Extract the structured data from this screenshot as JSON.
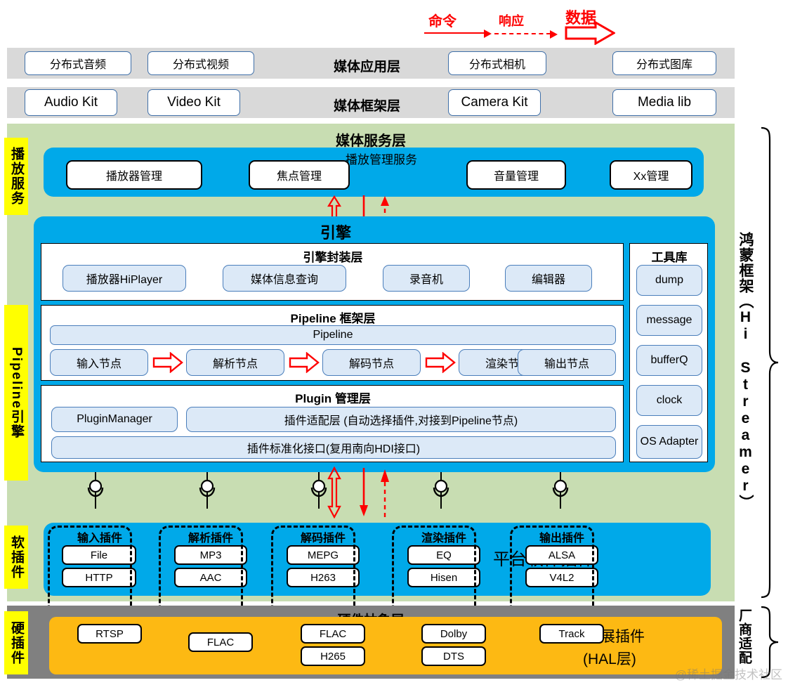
{
  "legend": {
    "command": "命令",
    "response": "响应",
    "data": "数据"
  },
  "layers": {
    "app": {
      "title": "媒体应用层",
      "items": [
        "分布式音频",
        "分布式视频",
        "分布式相机",
        "分布式图库"
      ]
    },
    "framework": {
      "title": "媒体框架层",
      "items": [
        "Audio Kit",
        "Video Kit",
        "Camera Kit",
        "Media lib"
      ]
    },
    "service": {
      "title": "媒体服务层",
      "panel_label": "播放管理服务",
      "items": [
        "播放器管理",
        "焦点管理",
        "音量管理",
        "Xx管理"
      ]
    },
    "engine": {
      "title": "引擎",
      "wrapper": {
        "title": "引擎封装层",
        "items": [
          "播放器HiPlayer",
          "媒体信息查询",
          "录音机",
          "编辑器"
        ]
      },
      "pipeline": {
        "title": "Pipeline 框架层",
        "bar": "Pipeline",
        "nodes": [
          "输入节点",
          "解析节点",
          "解码节点",
          "渲染节点",
          "输出节点"
        ]
      },
      "plugin": {
        "title": "Plugin 管理层",
        "manager": "PluginManager",
        "adapter": "插件适配层 (自动选择插件,对接到Pipeline节点)",
        "standard": "插件标准化接口(复用南向HDI接口)"
      },
      "toolkit": {
        "title": "工具库",
        "items": [
          "dump",
          "message",
          "bufferQ",
          "clock",
          "OS Adapter"
        ]
      }
    },
    "soft_plugins": {
      "label": "平台软件插件",
      "groups": [
        {
          "title": "输入插件",
          "items": [
            "File",
            "HTTP"
          ]
        },
        {
          "title": "解析插件",
          "items": [
            "MP3",
            "AAC"
          ]
        },
        {
          "title": "解码插件",
          "items": [
            "MEPG",
            "H263"
          ]
        },
        {
          "title": "渲染插件",
          "items": [
            "EQ",
            "Hisen"
          ]
        },
        {
          "title": "输出插件",
          "items": [
            "ALSA",
            "V4L2"
          ]
        }
      ]
    },
    "hal": {
      "title": "硬件抽象层",
      "label_line1": "厂商扩展插件",
      "label_line2": "(HAL层)",
      "groups": [
        {
          "items": [
            "RTSP"
          ]
        },
        {
          "items": [
            "FLAC"
          ]
        },
        {
          "items": [
            "FLAC",
            "H265"
          ]
        },
        {
          "items": [
            "Dolby",
            "DTS"
          ]
        },
        {
          "items": [
            "Track"
          ]
        }
      ]
    }
  },
  "side_tabs": {
    "left": [
      "播放服务",
      "Pipeline引擎",
      "软插件",
      "硬插件"
    ],
    "right": [
      "鸿蒙框架（Hi Streamer）",
      "厂商适配"
    ]
  },
  "watermark": "@稀土掘金技术社区",
  "colors": {
    "green_bg": "#c8ddb2",
    "blue_panel": "#00a9e9",
    "yellow_tab": "#ffff00",
    "gray_band": "#d9d9d9",
    "hal_gray": "#808080",
    "orange": "#fdb913",
    "red_accent": "#fe0000",
    "pill_fill": "#dce9f7"
  }
}
